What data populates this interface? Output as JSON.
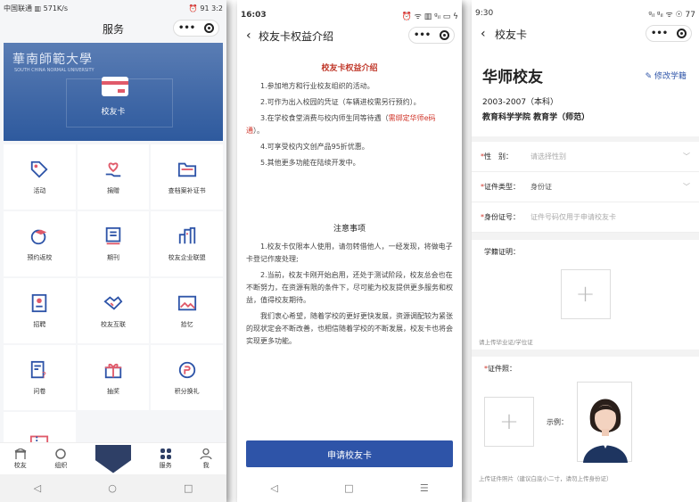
{
  "phone1": {
    "status_left": "中国联通 ▥ 571K/s",
    "status_right": "⏰ 91 3:2",
    "title": "服务",
    "capsule_more": "•••",
    "banner": {
      "logo_text": "華南師範大學",
      "logo_sub": "SOUTH CHINA NORMAL UNIVERSITY",
      "card_label": "校友卡"
    },
    "grid": [
      {
        "label": "活动",
        "icon": "tag-icon"
      },
      {
        "label": "捐赠",
        "icon": "heart-hand-icon"
      },
      {
        "label": "查档案补证书",
        "icon": "folder-icon"
      },
      {
        "label": "预约返校",
        "icon": "graduation-cap-icon"
      },
      {
        "label": "期刊",
        "icon": "journal-icon"
      },
      {
        "label": "校友企业联盟",
        "icon": "buildings-icon"
      },
      {
        "label": "招聘",
        "icon": "id-badge-icon"
      },
      {
        "label": "校友互联",
        "icon": "handshake-icon"
      },
      {
        "label": "拾忆",
        "icon": "photo-icon"
      },
      {
        "label": "问卷",
        "icon": "questionnaire-icon"
      },
      {
        "label": "抽奖",
        "icon": "gift-icon"
      },
      {
        "label": "积分换礼",
        "icon": "points-icon"
      },
      {
        "label": "",
        "icon": "ticket-icon"
      }
    ],
    "tabs": [
      {
        "label": "校友",
        "icon": "alumni-icon"
      },
      {
        "label": "组织",
        "icon": "organization-icon"
      },
      {
        "label": "",
        "icon": "school-emblem"
      },
      {
        "label": "服务",
        "icon": "service-icon"
      },
      {
        "label": "我",
        "icon": "me-icon"
      }
    ],
    "sysnav": [
      "◁",
      "○",
      "□"
    ]
  },
  "phone2": {
    "status_time": "16:03",
    "status_right": "⏰ ᯤ ▥ ᵍᵢₗ ▭ ϟ",
    "title": "校友卡权益介绍",
    "capsule_more": "•••",
    "heading": "校友卡权益介绍",
    "items": [
      "1.参加地方和行业校友组织的活动。",
      "2.可作为出入校园的凭证（车辆进校需另行预约）。",
      "3.在学校食堂消费与校内师生同等待遇（",
      "4.可享受校内文创产品95折优惠。",
      "5.其他更多功能在陆续开发中。"
    ],
    "item3_red": "需绑定华师e码通",
    "item3_tail": "）。",
    "notice_title": "注意事项",
    "notices": [
      "1.校友卡仅限本人使用，请勿转借他人，一经发现，将做电子卡登记作废处理;",
      "2.当前，校友卡刚开始启用，还处于测试阶段，校友总会也在不断努力，在资源有限的条件下，尽可能为校友提供更多服务和权益，值得校友期待。",
      "我们衷心希望，随着学校的更好更快发展，资源调配较为紧张的现状定会不断改善，也相信随着学校的不断发展，校友卡也将会实现更多功能。"
    ],
    "apply_button": "申请校友卡",
    "sysnav": [
      "◁",
      "□",
      "☰"
    ]
  },
  "phone3": {
    "status_time": "9:30",
    "status_right": "ᵍᵢₗ ᵍᵢₗ ᯤ ☉ 77",
    "title": "校友卡",
    "capsule_more": "•••",
    "name": "华师校友",
    "edit_label": "修改学籍",
    "years": "2003-2007（本科）",
    "major": "教育科学学院 教育学（师范）",
    "form": [
      {
        "label": "性　别：",
        "value": "请选择性别",
        "placeholder": true
      },
      {
        "label": "证件类型：",
        "value": "身份证",
        "placeholder": false
      },
      {
        "label": "身份证号：",
        "value": "证件号码仅用于申请校友卡",
        "placeholder": true
      }
    ],
    "xueji_label": "学籍证明：",
    "xueji_hint": "请上传毕业证/学位证",
    "photo_label": "证件照：",
    "example_label": "示例：",
    "photo_hint": "上传证件照片（建议白底小二寸，请勿上传身份证）",
    "plus": "+"
  },
  "colors": {
    "accent": "#2e54a8",
    "red": "#d0352a",
    "banner": "#3f67a6"
  }
}
